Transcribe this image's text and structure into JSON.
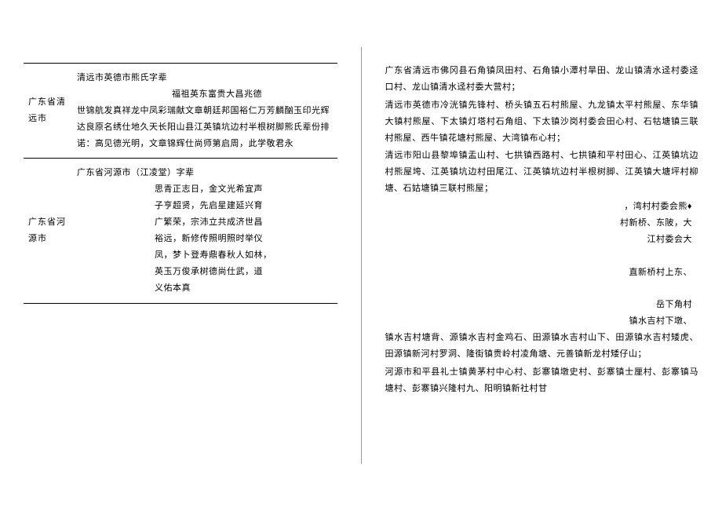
{
  "left_page": {
    "rows": [
      {
        "label": "广东省清远市",
        "title": "清远市英德市熊氏字辈",
        "subtitle_indent": "福祖英东富贵大昌兆德",
        "body": "世锦航发真祥龙中凤彩瑞献文章朝廷邦国裕仁万芳麟酗玉印光辉达良原名绣仕地久天长阳山县江英镇坑边村半根树脚熊氏辈份排诺：高见德光明，文章锦辉仕尚师第启周，此学敬君永"
      },
      {
        "label": "广东省河源市",
        "title": "广东省河源市（江凌堂）字辈",
        "body_lines": [
          "思青正志日，金文光希宜声",
          "子亨超贤，先启星建延兴育",
          "广繁荣，宗沛立共成济世昌",
          "裕远，新修传照明照时举仪",
          "凤，梦卜登寿鼎春秋人如林，",
          "英玉万俊承树德尚仕武，道",
          "义佑本真"
        ]
      }
    ]
  },
  "right_page": {
    "paragraphs": [
      "广东省清远市佛冈县石角镇凤田村、石角镇小潭村旱田、龙山镇清水迳村委迳口村、龙山镇清水迳村委大营村；",
      "清远市英德市冷洸镇先锋村、桥头镇五石村熊屋、九龙镇太平村熊屋、东华镇大镇村熊屋、下太镇灯塔村石角组、下太镇沙岗村委会田心村、石牯塘镇三联村熊屋、西牛镇花塘村熊屋、大湾镇布心村；",
      "清远市阳山县黎埠镇盂山村、七拱镇西路村、七拱镇和平村田心、江英镇坑边村熊屋垮、江英镇坑边村田尾江、江英镇坑边村半根树脚、江英镇大塘坪村柳塘、石姑塘镇三联村熊屋；"
    ],
    "right_lines": [
      "，湾村村委会熊♦",
      "村新桥、东陂，大",
      "江村委会大"
    ],
    "right_lines2": [
      "直新桥村上东、"
    ],
    "right_lines3": [
      "岳下角村"
    ],
    "right_lines4": [
      "镇水吉村下墩、"
    ],
    "paragraphs2": [
      "镇水吉村塘背、源镇水吉村金鸡石、田源镇水吉村山下、田源镇水吉村矮虎、田源镇新河村罗洞、隆街镇贵岭村凌角塘、元善镇新龙村矮仔山；",
      "河源市和平县礼士镇黄茅村中心村、彭寨镇墩史村、彭寨镇士厘村、彭寨镇马塘村、彭寨镇兴隆村九、阳明镇新社村甘"
    ]
  }
}
